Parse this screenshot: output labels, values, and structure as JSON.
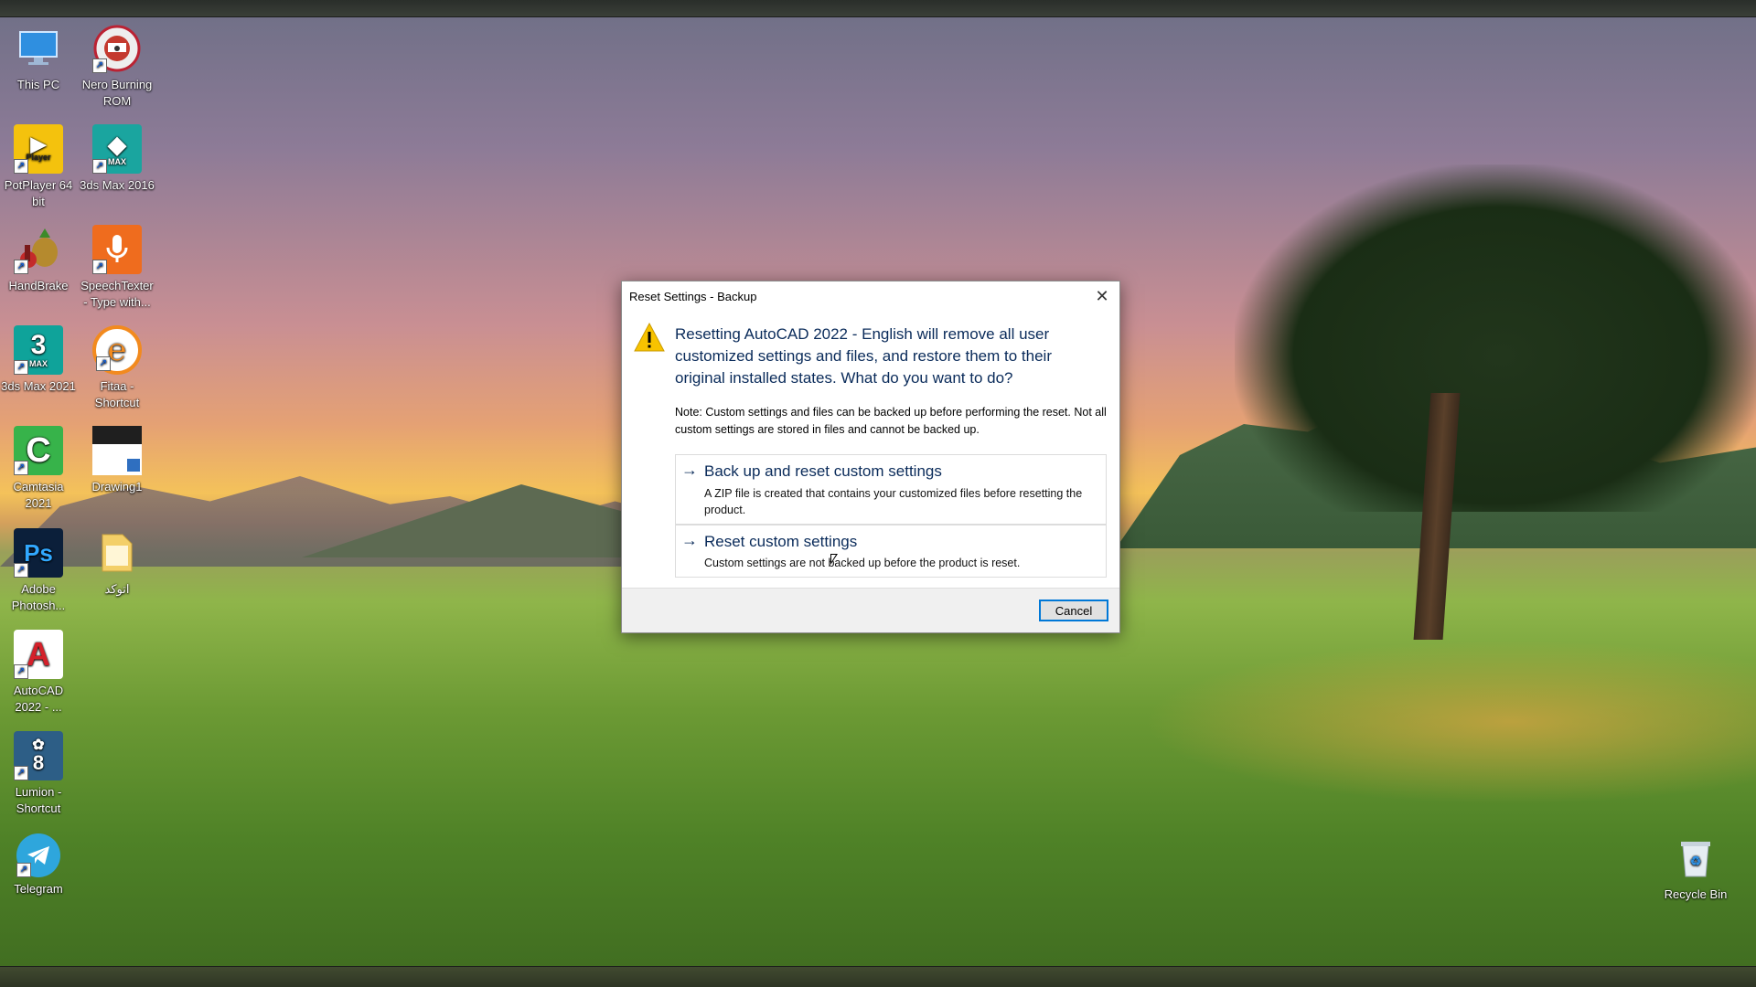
{
  "desktop": {
    "icons": [
      {
        "label": "This PC",
        "glyph": "monitor-icon",
        "color": "#2f8fe0"
      },
      {
        "label": "Nero Burning ROM",
        "glyph": "nero-icon",
        "color": "#c43a2f"
      },
      {
        "label": "PotPlayer 64 bit",
        "glyph": "potplayer-icon",
        "color": "#f4c20d",
        "badge": "Player"
      },
      {
        "label": "3ds Max 2016",
        "glyph": "3dsmax-icon",
        "color": "#1aa59f",
        "badge": "MAX"
      },
      {
        "label": "HandBrake",
        "glyph": "handbrake-icon",
        "color": "#8a6a2a"
      },
      {
        "label": "SpeechTexter - Type with...",
        "glyph": "microphone-icon",
        "color": "#ef6c1e"
      },
      {
        "label": "3ds Max 2021",
        "glyph": "3dsmax-icon",
        "color": "#0fa39a",
        "badge": "3"
      },
      {
        "label": "Fitaa - Shortcut",
        "glyph": "fitaa-icon",
        "color": "#f28a1e"
      },
      {
        "label": "Camtasia 2021",
        "glyph": "camtasia-icon",
        "color": "#37b34a"
      },
      {
        "label": "Drawing1",
        "glyph": "drawing-file-icon",
        "color": "#1f1f1f"
      },
      {
        "label": "Adobe Photosh...",
        "glyph": "photoshop-icon",
        "color": "#0b1f3a",
        "badge": "Ps"
      },
      {
        "label": "اتوکد",
        "glyph": "folder-icon",
        "color": "#f3cf68"
      },
      {
        "label": "AutoCAD 2022 - ...",
        "glyph": "autocad-icon",
        "color": "#d4202a",
        "badge": "A"
      },
      {
        "label": "Lumion - Shortcut",
        "glyph": "lumion-icon",
        "color": "#2d5e86",
        "badge": "8"
      },
      {
        "label": "Telegram",
        "glyph": "telegram-icon",
        "color": "#2ea6dc"
      },
      {
        "label": "Recycle Bin",
        "glyph": "recycle-bin-icon",
        "color": "#dfe7ee"
      }
    ]
  },
  "dialog": {
    "title": "Reset Settings - Backup",
    "close": "✕",
    "message": "Resetting AutoCAD 2022 - English will remove all user customized settings and files, and restore them to their original installed states. What do you want to do?",
    "note": "Note: Custom settings and files can be backed up before performing the reset. Not all custom settings are stored in files and cannot be backed up.",
    "options": [
      {
        "title": "Back up and reset custom settings",
        "desc": "A ZIP file is created that contains your customized files before resetting the product."
      },
      {
        "title": "Reset custom settings",
        "desc": "Custom settings are not backed up before the product is reset."
      }
    ],
    "cancel": "Cancel",
    "arrow": "→"
  }
}
